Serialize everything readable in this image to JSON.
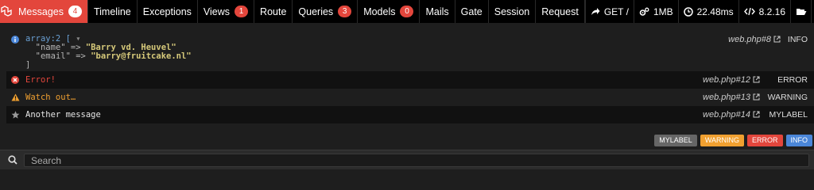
{
  "tabs": [
    {
      "label": "Messages",
      "badge": "4",
      "active": true
    },
    {
      "label": "Timeline"
    },
    {
      "label": "Exceptions"
    },
    {
      "label": "Views",
      "badge": "1"
    },
    {
      "label": "Route"
    },
    {
      "label": "Queries",
      "badge": "3"
    },
    {
      "label": "Models",
      "badge": "0"
    },
    {
      "label": "Mails"
    },
    {
      "label": "Gate"
    },
    {
      "label": "Session"
    },
    {
      "label": "Request"
    }
  ],
  "stats": {
    "method": "GET /",
    "memory": "1MB",
    "duration": "22.48ms",
    "php": "8.2.16"
  },
  "messages": [
    {
      "line1": "array:2 [",
      "line2_key": "\"name\" => ",
      "line2_val": "\"Barry vd. Heuvel\"",
      "line3_key": "\"email\" => ",
      "line3_val": "\"barry@fruitcake.nl\"",
      "line4": "]",
      "file": "web.php#8",
      "label": "INFO"
    },
    {
      "text": "Error!",
      "file": "web.php#12",
      "label": "ERROR"
    },
    {
      "text": "Watch out…",
      "file": "web.php#13",
      "label": "WARNING"
    },
    {
      "text": "Another message",
      "file": "web.php#14",
      "label": "MYLABEL"
    }
  ],
  "filters": [
    "MYLABEL",
    "WARNING",
    "ERROR",
    "INFO"
  ],
  "search": {
    "placeholder": "Search"
  },
  "colors": {
    "accent": "#e3463c",
    "warning": "#f0a030",
    "info": "#4a86d8",
    "muted": "#666666"
  }
}
